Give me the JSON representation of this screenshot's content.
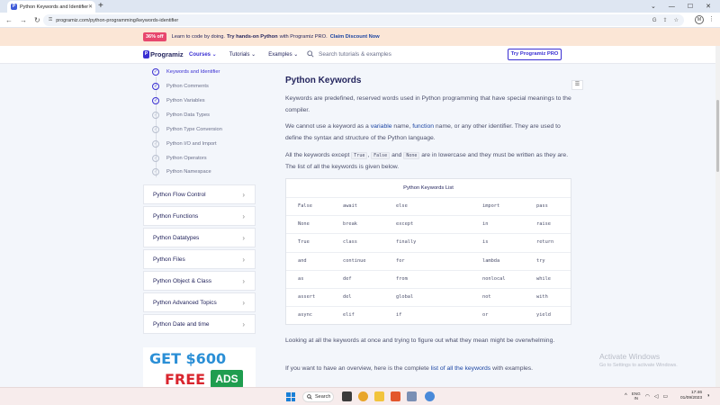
{
  "browser": {
    "tab_title": "Python Keywords and Identifiers",
    "favicon_letter": "P",
    "new_tab": "+",
    "url": "programiz.com/python-programming/keywords-identifier",
    "profile_initial": "M"
  },
  "promo": {
    "badge": "36% off",
    "text_a": "Learn to code by doing.",
    "text_b": "Try hands-on Python",
    "text_c": "with Programiz PRO.",
    "claim": "Claim Discount Now"
  },
  "header": {
    "logo": "Programiz",
    "nav": [
      "Courses",
      "Tutorials",
      "Examples"
    ],
    "search_placeholder": "Search tutorials & examples",
    "pro_button": "Try Programiz PRO"
  },
  "sidebar": {
    "topics": [
      {
        "label": "Keywords and Identifier",
        "state": "current"
      },
      {
        "label": "Python Comments",
        "state": "done"
      },
      {
        "label": "Python Variables",
        "state": "done"
      },
      {
        "label": "Python Data Types",
        "state": "todo"
      },
      {
        "label": "Python Type Conversion",
        "state": "todo"
      },
      {
        "label": "Python I/O and Import",
        "state": "todo"
      },
      {
        "label": "Python Operators",
        "state": "todo"
      },
      {
        "label": "Python Namespace",
        "state": "todo"
      }
    ],
    "sections": [
      "Python Flow Control",
      "Python Functions",
      "Python Datatypes",
      "Python Files",
      "Python Object & Class",
      "Python Advanced Topics",
      "Python Date and time"
    ],
    "ad": {
      "line1": "GET $600",
      "line2a": "FREE",
      "line2b": "ADS"
    }
  },
  "main": {
    "title": "Python Keywords",
    "p1": "Keywords are predefined, reserved words used in Python programming that have special meanings to the compiler.",
    "p2_a": "We cannot use a keyword as a ",
    "p2_link1": "variable",
    "p2_b": " name, ",
    "p2_link2": "function",
    "p2_c": " name, or any other identifier. They are used to define the syntax and structure of the Python language.",
    "p3_a": "All the keywords except ",
    "p3_code1": "True",
    "p3_b": ", ",
    "p3_code2": "False",
    "p3_c": " and ",
    "p3_code3": "None",
    "p3_d": " are in lowercase and they must be written as they are. The list of all the keywords is given below.",
    "table_title": "Python Keywords List",
    "keywords": [
      [
        "False",
        "await",
        "else",
        "import",
        "pass"
      ],
      [
        "None",
        "break",
        "except",
        "in",
        "raise"
      ],
      [
        "True",
        "class",
        "finally",
        "is",
        "return"
      ],
      [
        "and",
        "continue",
        "for",
        "lambda",
        "try"
      ],
      [
        "as",
        "def",
        "from",
        "nonlocal",
        "while"
      ],
      [
        "assert",
        "del",
        "global",
        "not",
        "with"
      ],
      [
        "async",
        "elif",
        "if",
        "or",
        "yield"
      ]
    ],
    "p4": "Looking at all the keywords at once and trying to figure out what they mean might be overwhelming.",
    "p5_a": "If you want to have an overview, here is the complete ",
    "p5_link": "list of all the keywords",
    "p5_b": " with examples."
  },
  "watermark": {
    "line1": "Activate Windows",
    "line2": "Go to Settings to activate Windows."
  },
  "taskbar": {
    "search": "Search",
    "lang_1": "ENG",
    "lang_2": "IN",
    "time": "17:46",
    "date": "01/09/2023"
  }
}
